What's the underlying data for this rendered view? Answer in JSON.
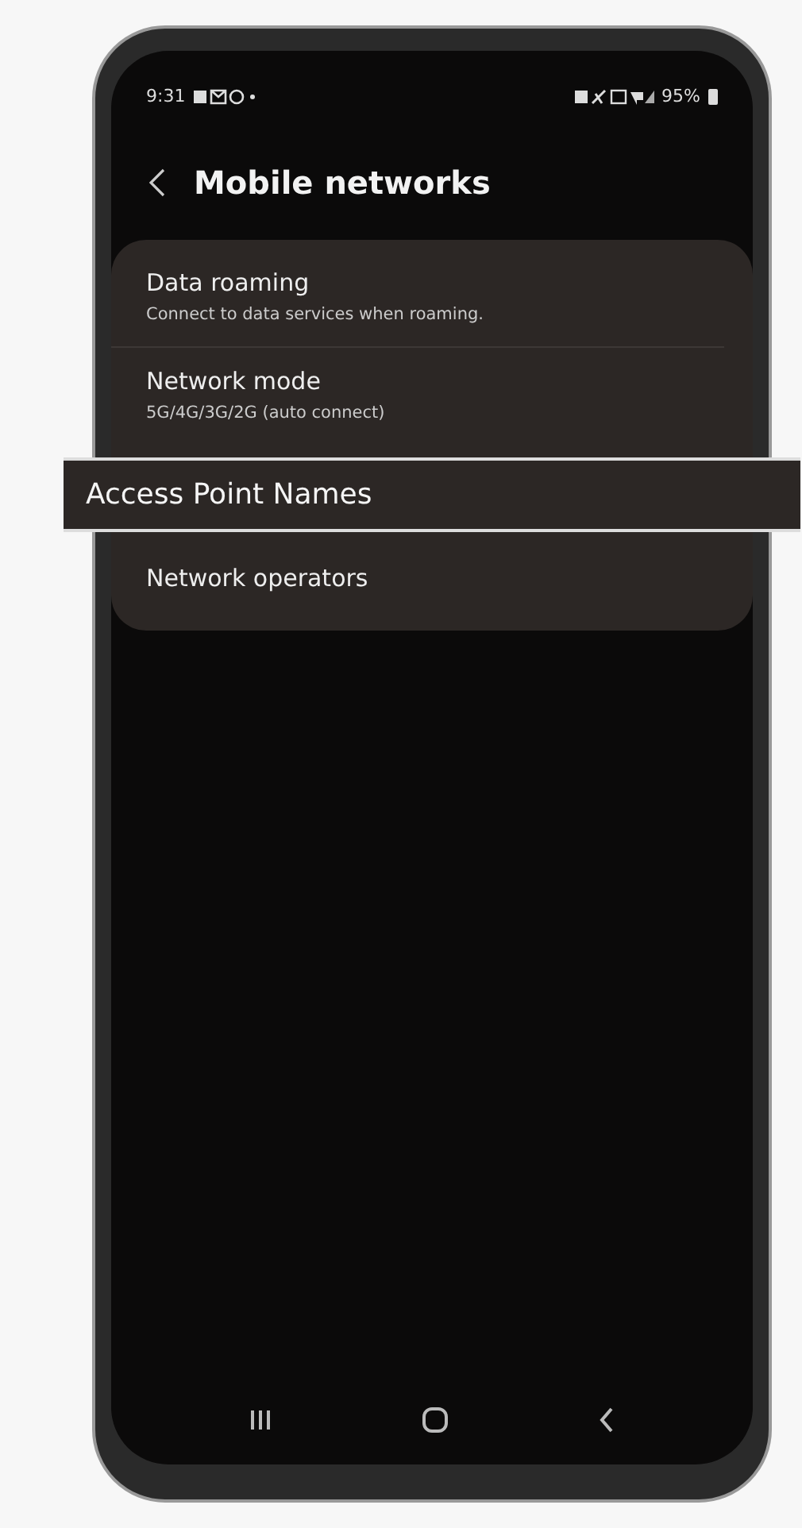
{
  "status_bar": {
    "time": "9:31",
    "battery": "95%"
  },
  "header": {
    "title": "Mobile networks"
  },
  "settings": [
    {
      "kind": "item",
      "title": "Data roaming",
      "subtitle": "Connect to data services when roaming."
    },
    {
      "kind": "item",
      "title": "Network mode",
      "subtitle": "5G/4G/3G/2G (auto connect)"
    },
    {
      "kind": "highlighted",
      "title": "Access Point Names"
    },
    {
      "kind": "item",
      "title": "Network operators"
    }
  ]
}
